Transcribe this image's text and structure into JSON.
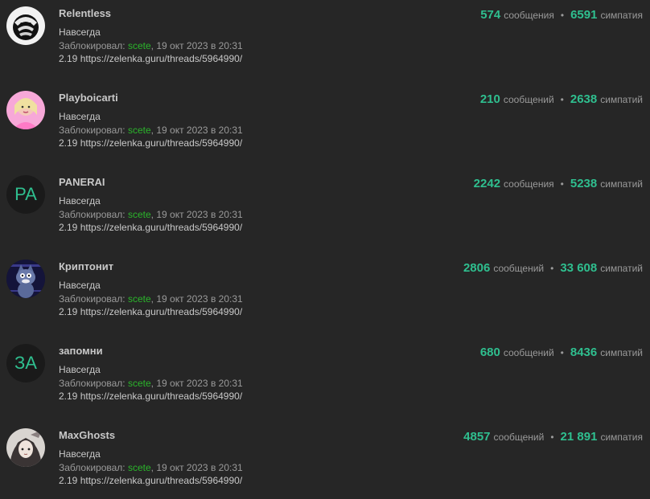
{
  "labels": {
    "banned_by": "Заблокировал:"
  },
  "entries": [
    {
      "username": "Relentless",
      "avatar": {
        "type": "image",
        "icon": "mask-icon"
      },
      "messages": "574",
      "messages_label": "сообщения",
      "likes": "6591",
      "likes_label": "симпатия",
      "duration": "Навсегда",
      "moderator": "scete",
      "date": "19 окт 2023 в 20:31",
      "reason": "2.19 https://zelenka.guru/threads/5964990/"
    },
    {
      "username": "Playboicarti",
      "avatar": {
        "type": "image",
        "icon": "pink-portrait-icon"
      },
      "messages": "210",
      "messages_label": "сообщений",
      "likes": "2638",
      "likes_label": "симпатий",
      "duration": "Навсегда",
      "moderator": "scete",
      "date": "19 окт 2023 в 20:31",
      "reason": "2.19 https://zelenka.guru/threads/5964990/"
    },
    {
      "username": "PANERAI",
      "avatar": {
        "type": "letters",
        "letters": "PA"
      },
      "messages": "2242",
      "messages_label": "сообщения",
      "likes": "5238",
      "likes_label": "симпатий",
      "duration": "Навсегда",
      "moderator": "scete",
      "date": "19 окт 2023 в 20:31",
      "reason": "2.19 https://zelenka.guru/threads/5964990/"
    },
    {
      "username": "Криптонит",
      "avatar": {
        "type": "image",
        "icon": "cartoon-cat-icon"
      },
      "messages": "2806",
      "messages_label": "сообщений",
      "likes": "33 608",
      "likes_label": "симпатий",
      "duration": "Навсегда",
      "moderator": "scete",
      "date": "19 окт 2023 в 20:31",
      "reason": "2.19 https://zelenka.guru/threads/5964990/"
    },
    {
      "username": "запомни",
      "avatar": {
        "type": "letters",
        "letters": "ЗА"
      },
      "messages": "680",
      "messages_label": "сообщений",
      "likes": "8436",
      "likes_label": "симпатий",
      "duration": "Навсегда",
      "moderator": "scete",
      "date": "19 окт 2023 в 20:31",
      "reason": "2.19 https://zelenka.guru/threads/5964990/"
    },
    {
      "username": "MaxGhosts",
      "avatar": {
        "type": "image",
        "icon": "anime-portrait-icon"
      },
      "messages": "4857",
      "messages_label": "сообщений",
      "likes": "21 891",
      "likes_label": "симпатия",
      "duration": "Навсегда",
      "moderator": "scete",
      "date": "19 окт 2023 в 20:31",
      "reason": "2.19 https://zelenka.guru/threads/5964990/"
    }
  ]
}
